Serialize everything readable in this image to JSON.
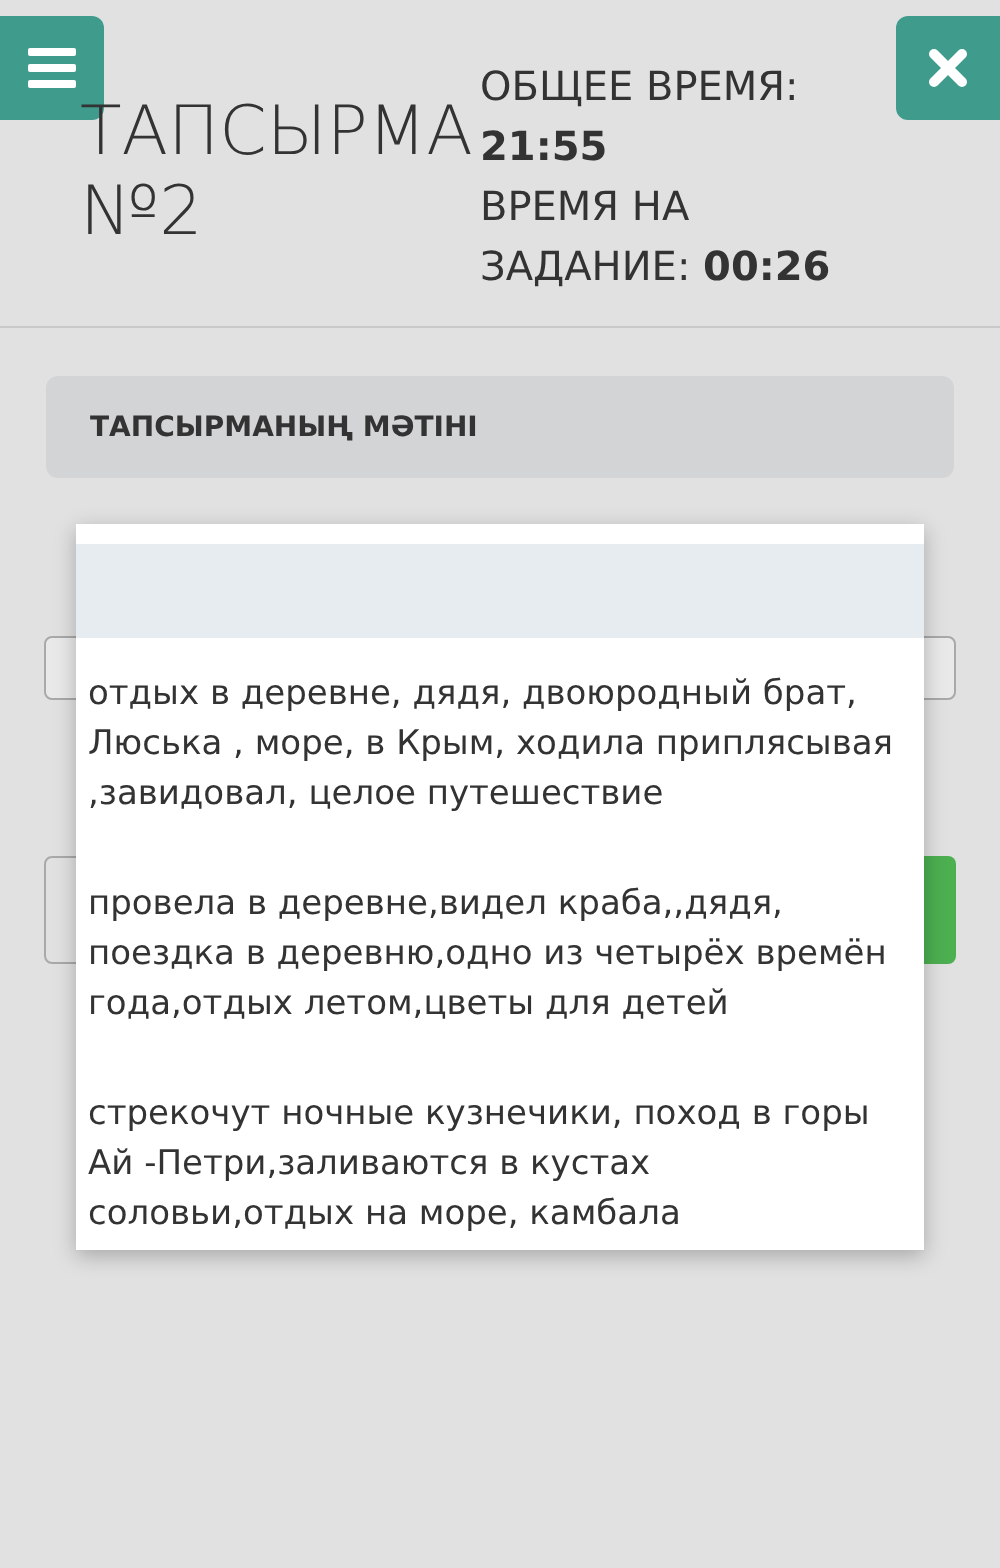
{
  "header": {
    "title_line_1": "ТАПСЫРМА",
    "title_line_2": "№2",
    "total_time_label": "ОБЩЕЕ ВРЕМЯ:",
    "total_time": "21:55",
    "task_time_label_line_1": "ВРЕМЯ НА",
    "task_time_label_line_2": "ЗАДАНИЕ:",
    "task_time": "00:26"
  },
  "section": {
    "title": "ТАПСЫРМАНЫҢ МӘТІНІ"
  },
  "dropdown": {
    "options": [
      {
        "selected": true
      },
      {
        "label": "отдых в деревне, дядя, двоюродный брат, Люська , море, в Крым, ходила приплясывая ,завидовал, целое путешествие",
        "selected": false
      },
      {
        "label": "провела в деревне,видел краба,,дядя, поездка в деревню,одно из четырёх времён года,отдых летом,цветы для детей",
        "selected": false
      },
      {
        "label": "стрекочут ночные кузнечики, поход в горы Ай -Петри,заливаются в кустах соловьи,отдых на море, камбала",
        "selected": false
      }
    ]
  }
}
